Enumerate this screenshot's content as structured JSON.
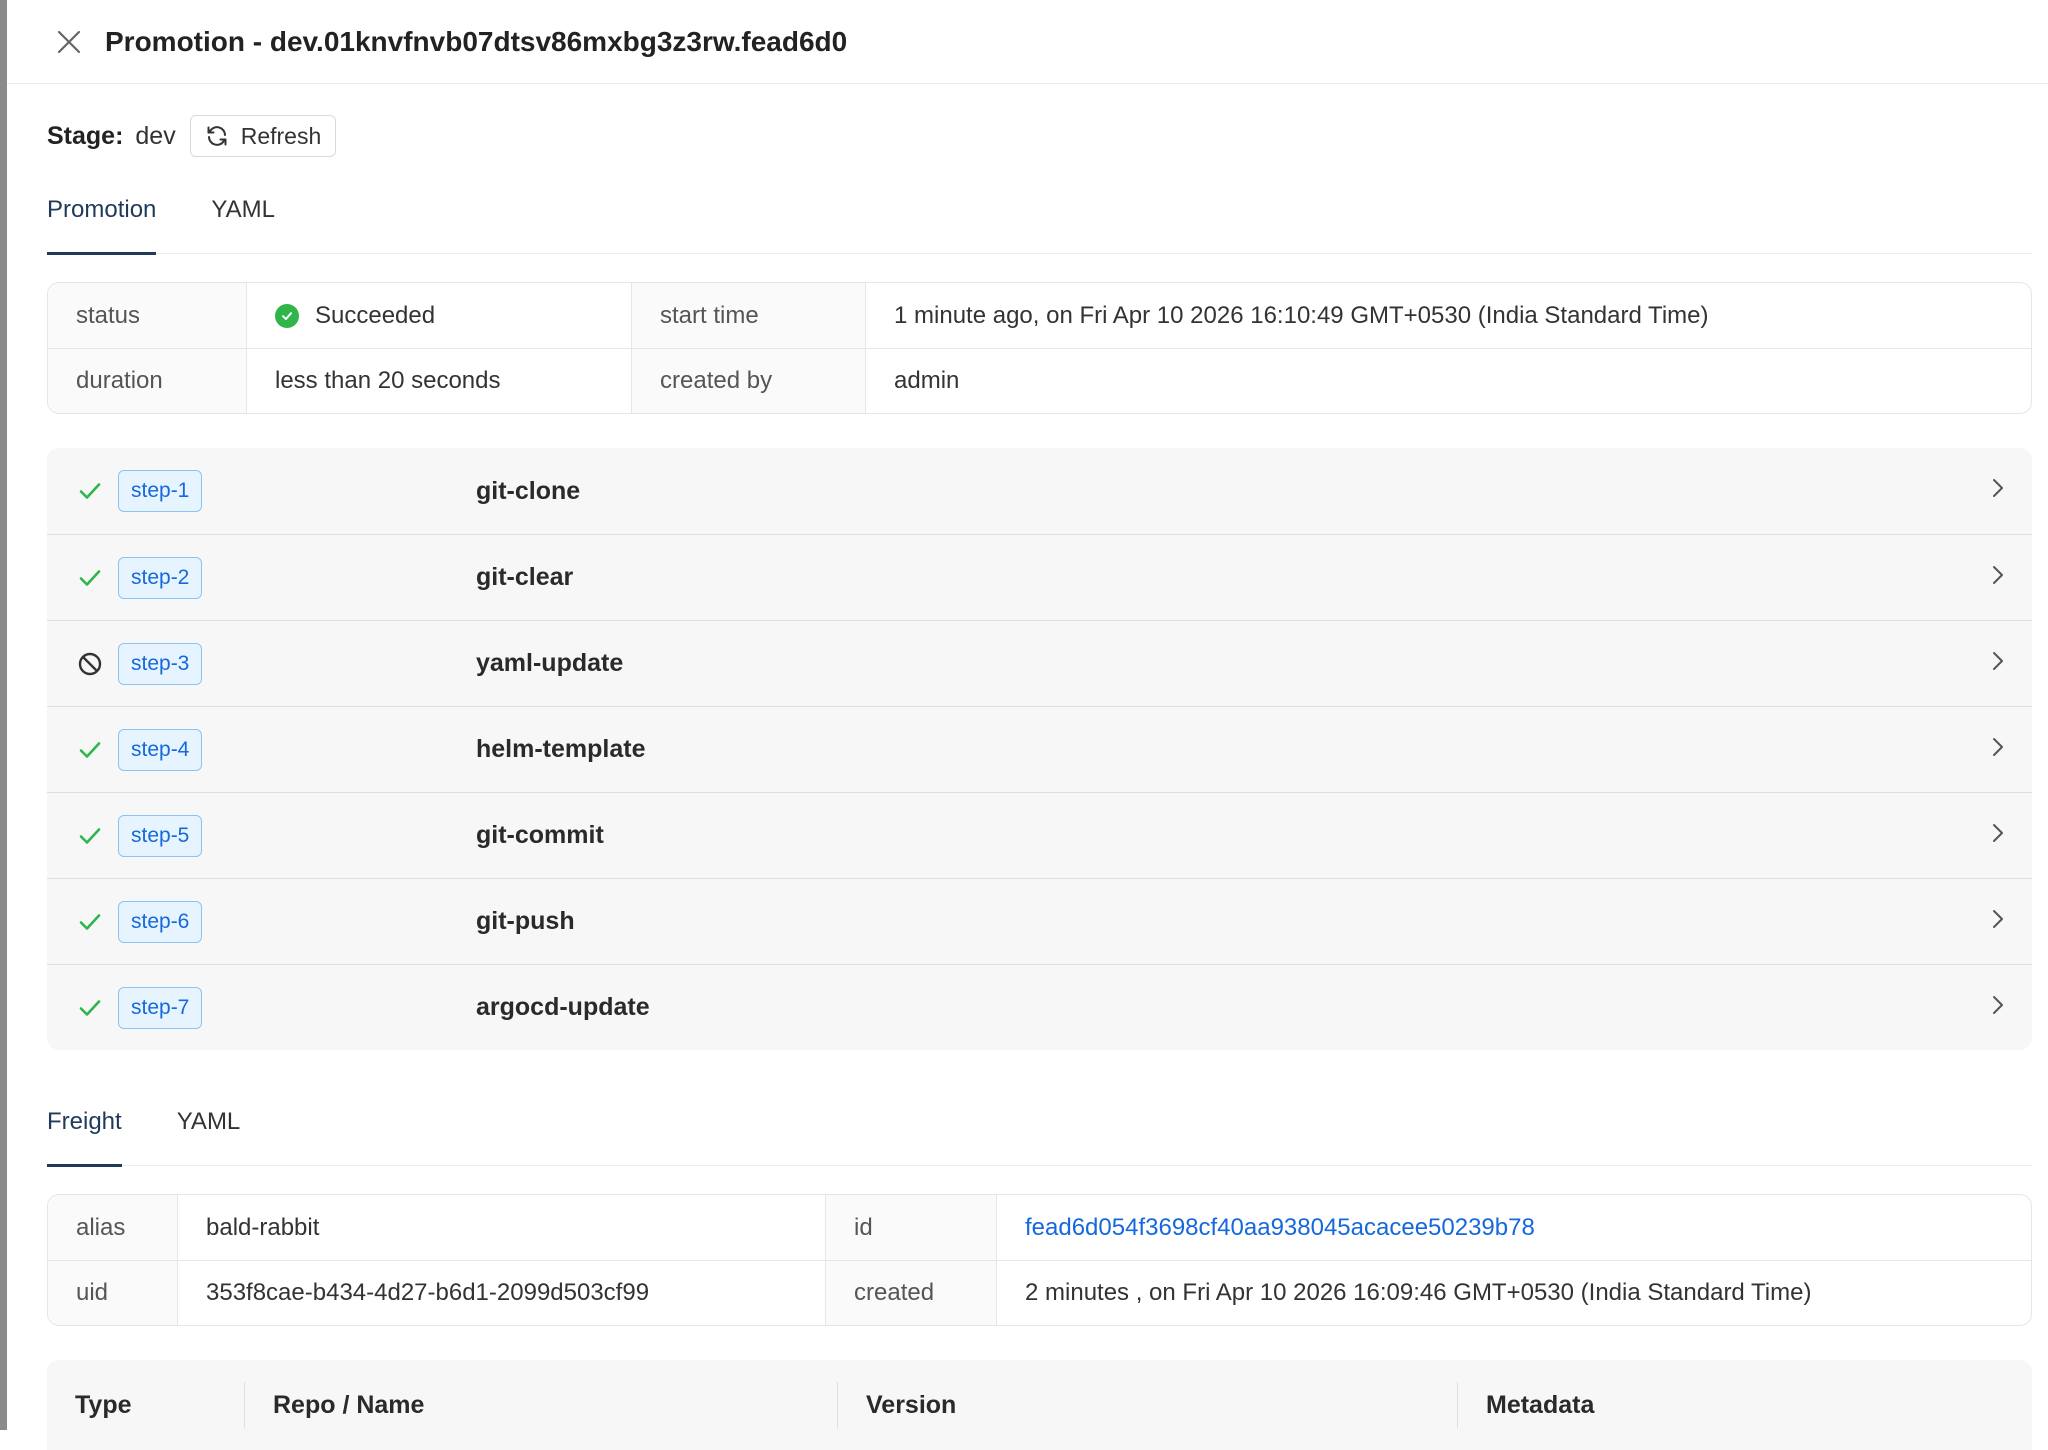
{
  "header": {
    "title": "Promotion - dev.01knvfnvb07dtsv86mxbg3z3rw.fead6d0"
  },
  "stage": {
    "label": "Stage:",
    "value": "dev",
    "refresh_label": "Refresh"
  },
  "promotion_tabs": [
    {
      "label": "Promotion",
      "active": true
    },
    {
      "label": "YAML",
      "active": false
    }
  ],
  "promotion_info": {
    "status_key": "status",
    "status_value": "Succeeded",
    "start_time_key": "start time",
    "start_time_value": "1 minute ago, on Fri Apr 10 2026 16:10:49 GMT+0530 (India Standard Time)",
    "duration_key": "duration",
    "duration_value": "less than 20 seconds",
    "created_by_key": "created by",
    "created_by_value": "admin"
  },
  "steps": [
    {
      "tag": "step-1",
      "name": "git-clone",
      "status": "succeeded"
    },
    {
      "tag": "step-2",
      "name": "git-clear",
      "status": "succeeded"
    },
    {
      "tag": "step-3",
      "name": "yaml-update",
      "status": "skipped"
    },
    {
      "tag": "step-4",
      "name": "helm-template",
      "status": "succeeded"
    },
    {
      "tag": "step-5",
      "name": "git-commit",
      "status": "succeeded"
    },
    {
      "tag": "step-6",
      "name": "git-push",
      "status": "succeeded"
    },
    {
      "tag": "step-7",
      "name": "argocd-update",
      "status": "succeeded"
    }
  ],
  "freight_tabs": [
    {
      "label": "Freight",
      "active": true
    },
    {
      "label": "YAML",
      "active": false
    }
  ],
  "freight_info": {
    "alias_key": "alias",
    "alias_value": "bald-rabbit",
    "id_key": "id",
    "id_value": "fead6d054f3698cf40aa938045acacee50239b78",
    "uid_key": "uid",
    "uid_value": "353f8cae-b434-4d27-b6d1-2099d503cf99",
    "created_key": "created",
    "created_value": "2 minutes , on Fri Apr 10 2026 16:09:46 GMT+0530 (India Standard Time)"
  },
  "artifact_table": {
    "columns": [
      "Type",
      "Repo / Name",
      "Version",
      "Metadata"
    ]
  },
  "colors": {
    "success": "#2fb54a",
    "tag_blue": "#1668dc",
    "tag_bg": "#e6f4ff",
    "active_tab": "#1f3a5a"
  },
  "icons": {
    "close": "close-icon",
    "refresh": "refresh-icon",
    "succeeded": "check-circle-icon",
    "step_succeeded": "check-icon",
    "step_skipped": "ban-icon",
    "expand": "chevron-right-icon"
  }
}
